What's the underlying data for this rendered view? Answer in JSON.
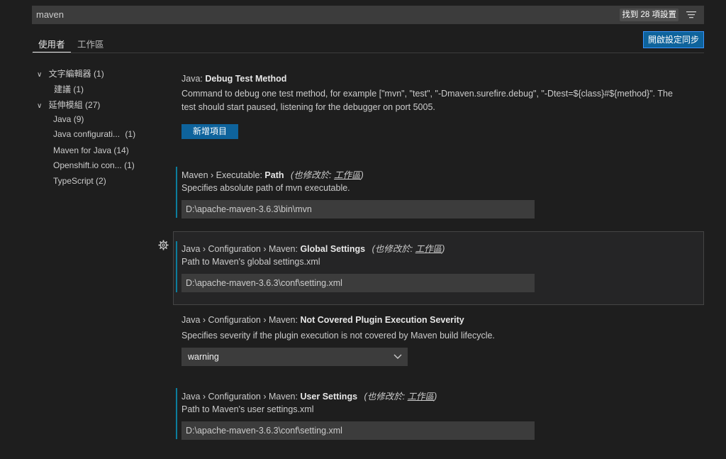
{
  "search": {
    "query": "maven",
    "result_count": "找到 28 項設置"
  },
  "tabs": {
    "user": "使用者",
    "workspace": "工作區"
  },
  "sync_button": "開啟設定同步",
  "toc": {
    "items": [
      {
        "label": "文字編輯器",
        "count": "(1)",
        "expanded": true
      },
      {
        "label": "建議",
        "count": "(1)"
      },
      {
        "label": "延伸模組",
        "count": "(27)",
        "expanded": true
      },
      {
        "label": "Java",
        "count": "(9)"
      },
      {
        "label": "Java configurati...",
        "count": "(1)"
      },
      {
        "label": "Maven for Java",
        "count": "(14)"
      },
      {
        "label": "Openshift.io con...",
        "count": "(1)"
      },
      {
        "label": "TypeScript",
        "count": "(2)"
      }
    ]
  },
  "settings": {
    "debug_test": {
      "category": "Java: ",
      "name": "Debug Test Method",
      "desc_line1": "Command to debug one test method, for example [\"mvn\", \"test\", \"-Dmaven.surefire.debug\", \"-Dtest=${class}#${method}\". The",
      "desc_line2": "test should start paused, listening for the debugger on port 5005.",
      "button": "新增項目"
    },
    "executable_path": {
      "category": "Maven › Executable: ",
      "name": "Path",
      "modified_prefix": "(也修改於: ",
      "modified_link": "工作區",
      "modified_suffix": ")",
      "desc": "Specifies absolute path of mvn executable.",
      "value": "D:\\apache-maven-3.6.3\\bin\\mvn"
    },
    "global_settings": {
      "category": "Java › Configuration › Maven: ",
      "name": "Global Settings",
      "modified_prefix": "(也修改於: ",
      "modified_link": "工作區",
      "modified_suffix": ")",
      "desc": "Path to Maven's global settings.xml",
      "value": "D:\\apache-maven-3.6.3\\conf\\setting.xml"
    },
    "not_covered": {
      "category": "Java › Configuration › Maven: ",
      "name": "Not Covered Plugin Execution Severity",
      "desc": "Specifies severity if the plugin execution is not covered by Maven build lifecycle.",
      "value": "warning"
    },
    "user_settings": {
      "category": "Java › Configuration › Maven: ",
      "name": "User Settings",
      "modified_prefix": "(也修改於: ",
      "modified_link": "工作區",
      "modified_suffix": ")",
      "desc": "Path to Maven's user settings.xml",
      "value": "D:\\apache-maven-3.6.3\\conf\\setting.xml"
    }
  },
  "icons": {
    "filter": "filter-icon",
    "gear": "gear-icon",
    "chevron": "chevron-down-icon"
  },
  "colors": {
    "accent": "#0e639c",
    "modified_bar": "#0c7d9d",
    "background": "#1e1e1e"
  }
}
